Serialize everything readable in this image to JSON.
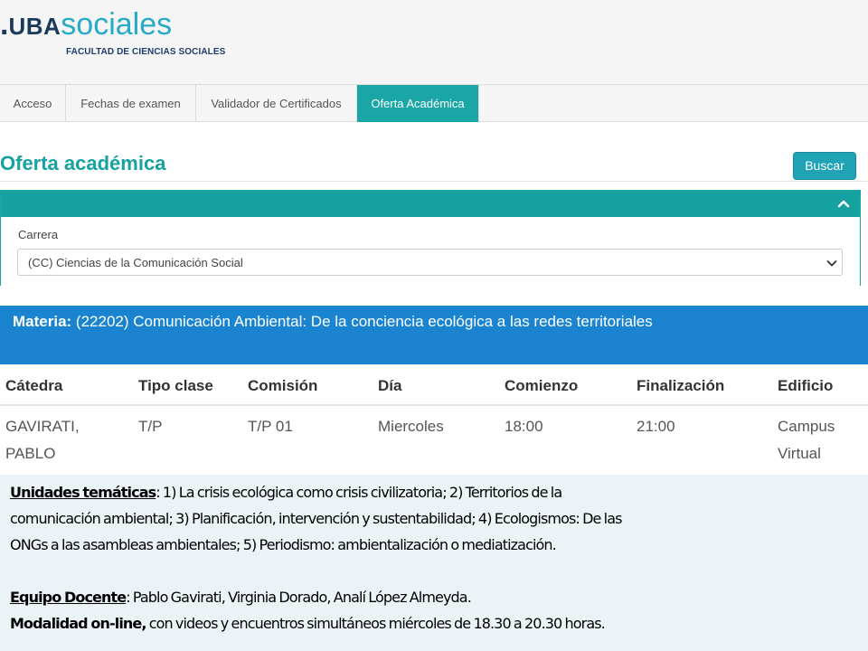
{
  "header": {
    "logo_dot": ".",
    "logo_uba": "UBA",
    "logo_sociales": "sociales",
    "logo_subtitle": "FACULTAD DE CIENCIAS SOCIALES"
  },
  "tabs": [
    {
      "label": "Acceso",
      "active": false
    },
    {
      "label": "Fechas de examen",
      "active": false
    },
    {
      "label": "Validador de Certificados",
      "active": false
    },
    {
      "label": "Oferta Académica",
      "active": true
    }
  ],
  "page": {
    "title": "Oferta académica",
    "search_button": "Buscar"
  },
  "filter": {
    "carrera_label": "Carrera",
    "carrera_value": "(CC) Ciencias de la Comunicación Social"
  },
  "materia": {
    "label": "Materia:",
    "value": "(22202) Comunicación Ambiental: De la conciencia ecológica a las redes territoriales"
  },
  "table": {
    "headers": [
      "Cátedra",
      "Tipo clase",
      "Comisión",
      "Día",
      "Comienzo",
      "Finalización",
      "Edificio"
    ],
    "row": {
      "catedra_1": "GAVIRATI,",
      "catedra_2": "PABLO",
      "tipo": "T/P",
      "comision": "T/P 01",
      "dia": "Miercoles",
      "comienzo": "18:00",
      "finalizacion": "21:00",
      "edificio_1": "Campus",
      "edificio_2": "Virtual"
    }
  },
  "notes": {
    "unidades_label": "Unidades temáticas",
    "unidades_line1": ": 1)  La crisis ecológica como crisis civilizatoria; 2) Territorios de la",
    "unidades_line2": "comunicación ambiental; 3) Planificación, intervención y sustentabilidad; 4) Ecologismos: De las",
    "unidades_line3": "ONGs a las asambleas ambientales; 5) Periodismo: ambientalización o mediatización.",
    "equipo_label": "Equipo Docente",
    "equipo_text": ": Pablo Gavirati, Virginia Dorado, Analí López Almeyda.",
    "modalidad_label": "Modalidad on-line,",
    "modalidad_text": " con videos y encuentros simultáneos miércoles de 18.30 a 20.30 horas."
  },
  "colors": {
    "teal": "#17a2a2",
    "band_blue": "#1a84d0",
    "notes_bg": "#ecf3f7"
  }
}
